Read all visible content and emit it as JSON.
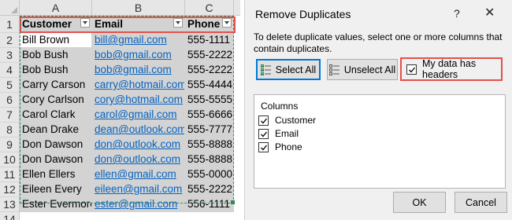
{
  "sheet": {
    "col_letters": [
      "A",
      "B",
      "C"
    ],
    "header_row": {
      "num": "1",
      "cells": [
        "Customer",
        "Email",
        "Phone"
      ]
    },
    "rows": [
      {
        "num": "2",
        "name": "Bill Brown",
        "email": "bill@gmail.com",
        "phone": "555-1111"
      },
      {
        "num": "3",
        "name": "Bob Bush",
        "email": "bob@gmail.com",
        "phone": "555-2222"
      },
      {
        "num": "4",
        "name": "Bob Bush",
        "email": "bob@gmail.com",
        "phone": "555-2222"
      },
      {
        "num": "5",
        "name": "Carry Carson",
        "email": "carry@hotmail.com",
        "phone": "555-4444"
      },
      {
        "num": "6",
        "name": "Cory Carlson",
        "email": "cory@hotmail.com",
        "phone": "555-5555"
      },
      {
        "num": "7",
        "name": "Carol Clark",
        "email": "carol@gmail.com",
        "phone": "555-6666"
      },
      {
        "num": "8",
        "name": "Dean Drake",
        "email": "dean@outlook.com",
        "phone": "555-7777"
      },
      {
        "num": "9",
        "name": "Don Dawson",
        "email": "don@outlook.com",
        "phone": "555-8888"
      },
      {
        "num": "10",
        "name": "Don Dawson",
        "email": "don@outlook.com",
        "phone": "555-8888"
      },
      {
        "num": "11",
        "name": "Ellen Ellers",
        "email": "ellen@gmail.com",
        "phone": "555-0000"
      },
      {
        "num": "12",
        "name": "Eileen Every",
        "email": "eileen@gmail.com",
        "phone": "555-2222"
      },
      {
        "num": "13",
        "name": "Ester Evermore",
        "email": "ester@gmail.com",
        "phone": "556-1111"
      }
    ],
    "extra_row_num": "14"
  },
  "dialog": {
    "title": "Remove Duplicates",
    "help": "?",
    "close": "✕",
    "description": "To delete duplicate values, select one or more columns that contain duplicates.",
    "select_all_label": "Select All",
    "unselect_all_label": "Unselect All",
    "headers_checkbox_label": "My data has headers",
    "headers_checked": true,
    "columns_title": "Columns",
    "columns": [
      {
        "label": "Customer",
        "checked": true
      },
      {
        "label": "Email",
        "checked": true
      },
      {
        "label": "Phone",
        "checked": true
      }
    ],
    "ok_label": "OK",
    "cancel_label": "Cancel"
  },
  "colors": {
    "highlight": "#e4504a",
    "selection_gray": "#d3d3d3",
    "link": "#0563c1",
    "primary_border": "#0078d7"
  }
}
